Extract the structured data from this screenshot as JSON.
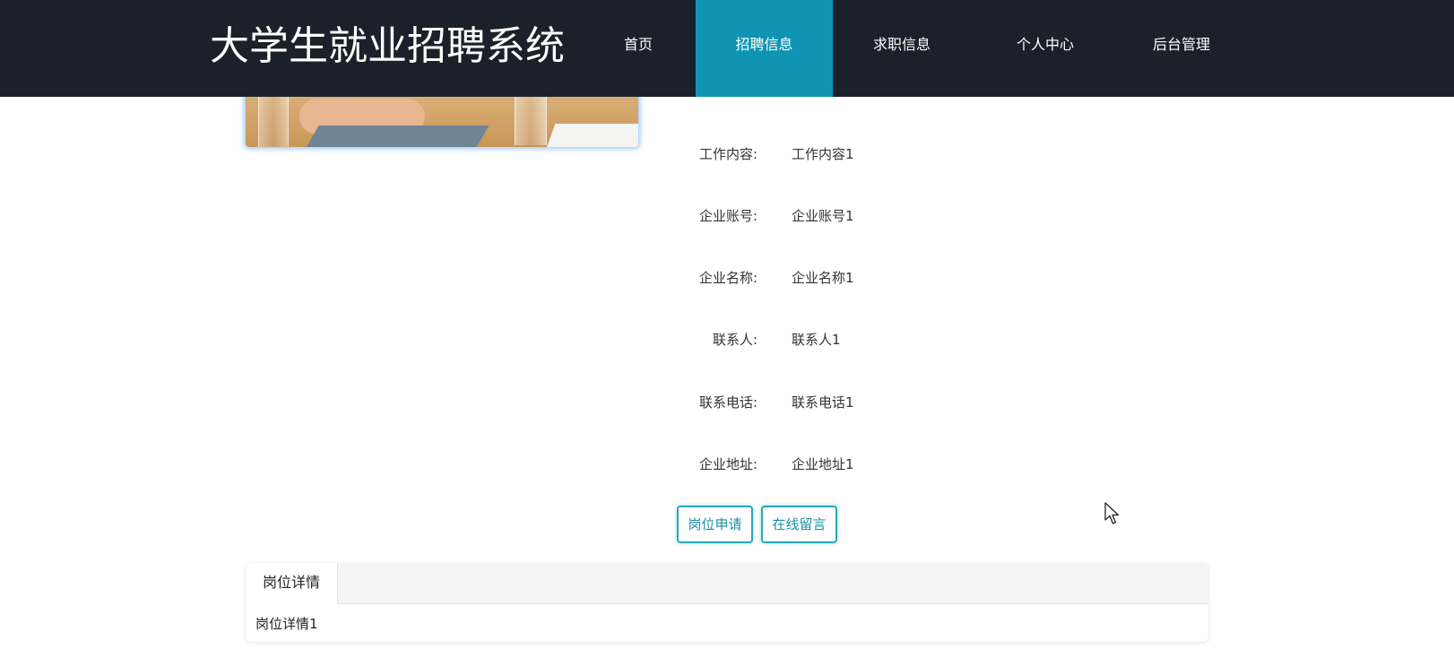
{
  "header": {
    "title": "大学生就业招聘系统",
    "nav": [
      {
        "label": "首页",
        "active": false
      },
      {
        "label": "招聘信息",
        "active": true
      },
      {
        "label": "求职信息",
        "active": false
      },
      {
        "label": "个人中心",
        "active": false
      },
      {
        "label": "后台管理",
        "active": false
      }
    ]
  },
  "details": [
    {
      "label": "工作内容:",
      "value": "工作内容1"
    },
    {
      "label": "企业账号:",
      "value": "企业账号1"
    },
    {
      "label": "企业名称:",
      "value": "企业名称1"
    },
    {
      "label": "联系人:",
      "value": "联系人1"
    },
    {
      "label": "联系电话:",
      "value": "联系电话1"
    },
    {
      "label": "企业地址:",
      "value": "企业地址1"
    }
  ],
  "actions": {
    "apply_label": "岗位申请",
    "message_label": "在线留言"
  },
  "tabs": {
    "active_label": "岗位详情",
    "content": "岗位详情1"
  },
  "colors": {
    "header_bg": "#1b212b",
    "active_nav_bg": "#0f95b3",
    "button_accent": "#2aa8b8"
  }
}
